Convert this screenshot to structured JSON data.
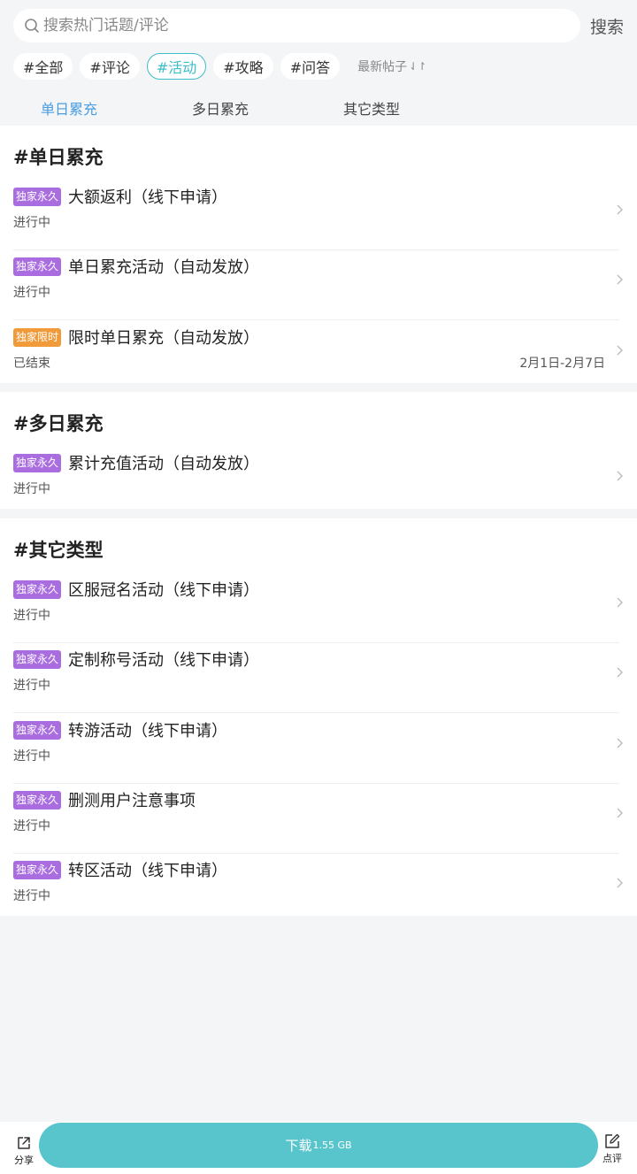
{
  "search": {
    "placeholder": "搜索热门话题/评论",
    "button_label": "搜索"
  },
  "tags": [
    "#全部",
    "#评论",
    "#活动",
    "#攻略",
    "#问答"
  ],
  "sort_label": "最新帖子",
  "tabs": [
    "单日累充",
    "多日累充",
    "其它类型"
  ],
  "sections": [
    {
      "title": "#单日累充",
      "items": [
        {
          "badge": "独家永久",
          "title": "大额返利（线下申请）",
          "status": "进行中"
        },
        {
          "badge": "独家永久",
          "title": "单日累充活动（自动发放）",
          "status": "进行中"
        },
        {
          "badge": "独家限时",
          "title": "限时单日累充（自动发放）",
          "status": "已结束",
          "date": "2月1日-2月7日"
        }
      ]
    },
    {
      "title": "#多日累充",
      "items": [
        {
          "badge": "独家永久",
          "title": "累计充值活动（自动发放）",
          "status": "进行中"
        }
      ]
    },
    {
      "title": "#其它类型",
      "items": [
        {
          "badge": "独家永久",
          "title": "区服冠名活动（线下申请）",
          "status": "进行中"
        },
        {
          "badge": "独家永久",
          "title": "定制称号活动（线下申请）",
          "status": "进行中"
        },
        {
          "badge": "独家永久",
          "title": "转游活动（线下申请）",
          "status": "进行中"
        },
        {
          "badge": "独家永久",
          "title": "删测用户注意事项",
          "status": "进行中"
        },
        {
          "badge": "独家永久",
          "title": "转区活动（线下申请）",
          "status": "进行中"
        }
      ]
    }
  ],
  "bottom": {
    "share_label": "分享",
    "download_label": "下载",
    "download_size": "1.55 GB",
    "review_label": "点评"
  },
  "colors": {
    "accent": "#3dbdc6",
    "tab_active": "#4a9de0",
    "badge_purple": "#a96de0",
    "badge_orange": "#f09a3a",
    "download": "#57c5cb"
  }
}
